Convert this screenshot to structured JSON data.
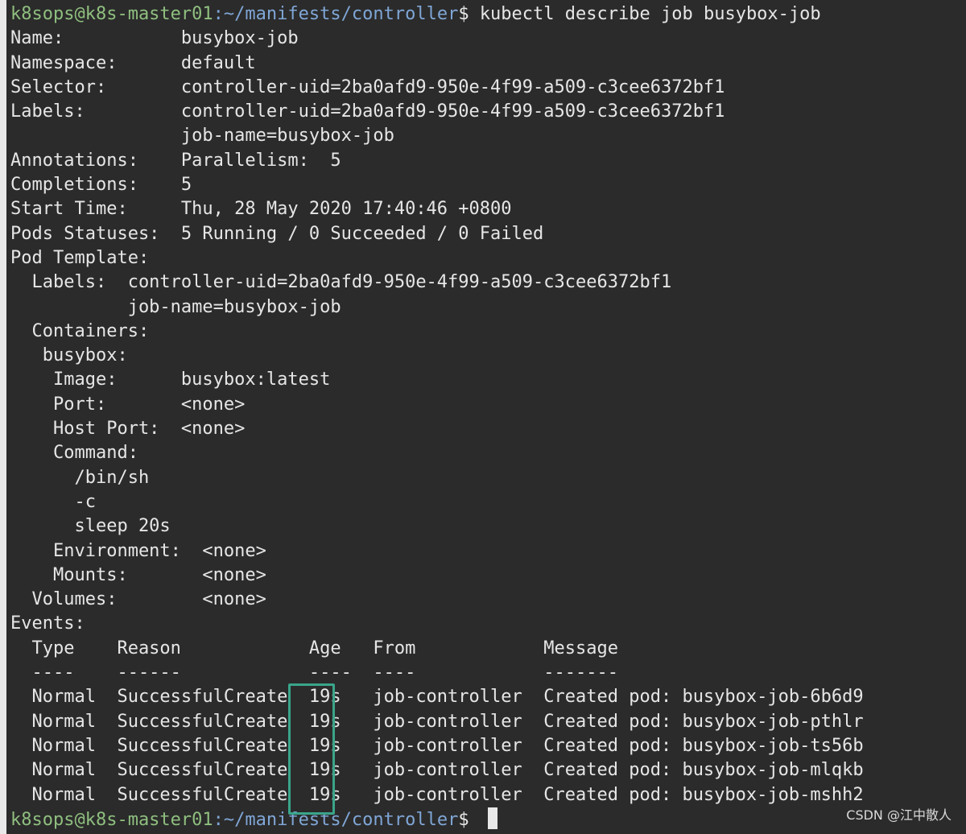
{
  "terminal": {
    "prompt_user": "k8sops@k8s-master01",
    "prompt_path": ":~/manifests/controller",
    "prompt_sign": "$ ",
    "command": "kubectl describe job busybox-job",
    "describe_lines": [
      "Name:           busybox-job",
      "Namespace:      default",
      "Selector:       controller-uid=2ba0afd9-950e-4f99-a509-c3cee6372bf1",
      "Labels:         controller-uid=2ba0afd9-950e-4f99-a509-c3cee6372bf1",
      "                job-name=busybox-job",
      "Annotations:    Parallelism:  5",
      "Completions:    5",
      "Start Time:     Thu, 28 May 2020 17:40:46 +0800",
      "Pods Statuses:  5 Running / 0 Succeeded / 0 Failed",
      "Pod Template:",
      "  Labels:  controller-uid=2ba0afd9-950e-4f99-a509-c3cee6372bf1",
      "           job-name=busybox-job",
      "  Containers:",
      "   busybox:",
      "    Image:      busybox:latest",
      "    Port:       <none>",
      "    Host Port:  <none>",
      "    Command:",
      "      /bin/sh",
      "      -c",
      "      sleep 20s",
      "    Environment:  <none>",
      "    Mounts:       <none>",
      "  Volumes:        <none>",
      "Events:"
    ],
    "events_header": "  Type    Reason            Age   From            Message",
    "events_separator": "  ----    ------            ----  ----            -------",
    "events": [
      "  Normal  SuccessfulCreate  19s   job-controller  Created pod: busybox-job-6b6d9",
      "  Normal  SuccessfulCreate  19s   job-controller  Created pod: busybox-job-pthlr",
      "  Normal  SuccessfulCreate  19s   job-controller  Created pod: busybox-job-ts56b",
      "  Normal  SuccessfulCreate  19s   job-controller  Created pod: busybox-job-mlqkb",
      "  Normal  SuccessfulCreate  19s   job-controller  Created pod: busybox-job-mshh2"
    ]
  },
  "watermark": "CSDN @江中散人",
  "colors": {
    "background": "#2b2b2b",
    "text": "#e6e6e6",
    "prompt_user": "#8fbf7f",
    "prompt_path": "#7fa6d6",
    "highlight": "#3aa58a"
  }
}
